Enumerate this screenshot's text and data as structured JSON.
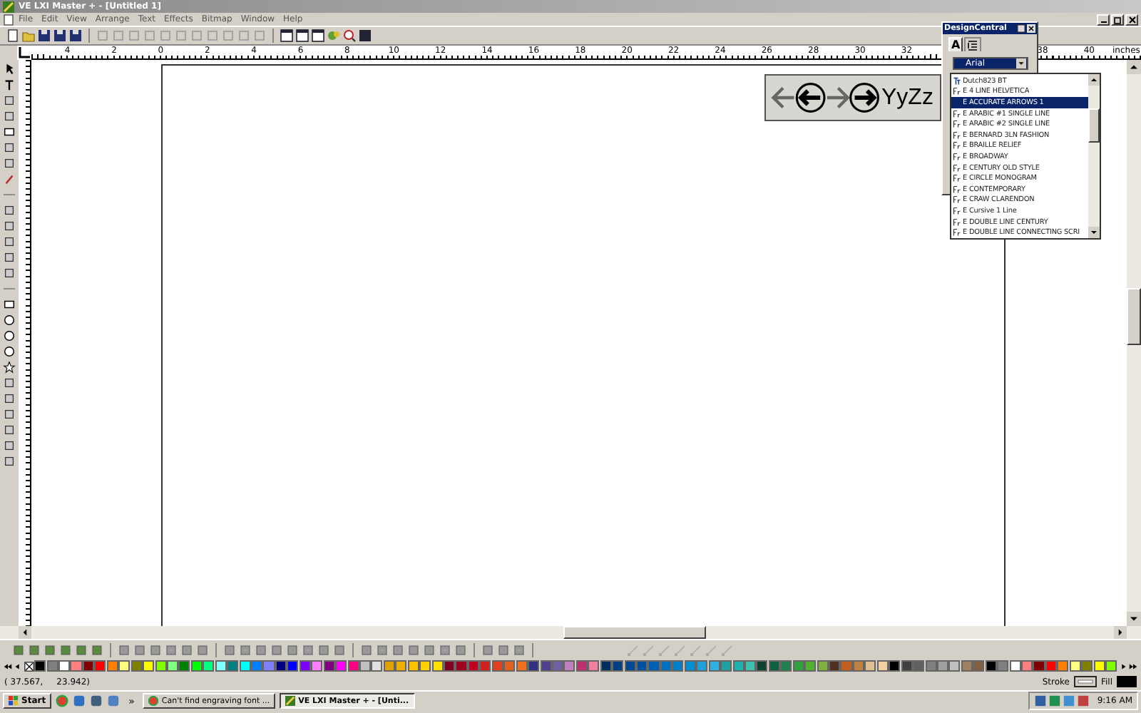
{
  "window": {
    "title": "VE LXI Master + - [Untitled 1]"
  },
  "menu": [
    "File",
    "Edit",
    "View",
    "Arrange",
    "Text",
    "Effects",
    "Bitmap",
    "Window",
    "Help"
  ],
  "ruler": {
    "labels": [
      "4",
      "2",
      "0",
      "2",
      "4",
      "6",
      "8",
      "10",
      "12",
      "14",
      "16",
      "18",
      "20",
      "22",
      "24",
      "26",
      "28",
      "30",
      "32"
    ],
    "labels_end": [
      "38",
      "40"
    ],
    "unit": "inches"
  },
  "preview": {
    "sample_text": "YyZz"
  },
  "design_central": {
    "title": "DesignCentral",
    "tabs": [
      {
        "kind": "text",
        "label": "A",
        "selected": true
      },
      {
        "kind": "icon",
        "selected": false
      }
    ],
    "font_field": {
      "value": "Arial"
    }
  },
  "font_list": {
    "items": [
      {
        "name": "Dutch823 BT",
        "kind": "truetype",
        "selected": false
      },
      {
        "name": "E 4 LINE HELVETICA",
        "kind": "engraving",
        "selected": false
      },
      {
        "name": "E ACCURATE ARROWS 1",
        "kind": "engraving",
        "selected": true
      },
      {
        "name": "E ARABIC #1 SINGLE LINE",
        "kind": "engraving",
        "selected": false
      },
      {
        "name": "E ARABIC #2 SINGLE LINE",
        "kind": "engraving",
        "selected": false
      },
      {
        "name": "E BERNARD 3LN FASHION",
        "kind": "engraving",
        "selected": false
      },
      {
        "name": "E BRAILLE RELIEF",
        "kind": "engraving",
        "selected": false
      },
      {
        "name": "E BROADWAY",
        "kind": "engraving",
        "selected": false
      },
      {
        "name": "E CENTURY OLD STYLE",
        "kind": "engraving",
        "selected": false
      },
      {
        "name": "E CIRCLE MONOGRAM",
        "kind": "engraving",
        "selected": false
      },
      {
        "name": "E CONTEMPORARY",
        "kind": "engraving",
        "selected": false
      },
      {
        "name": "E CRAW CLARENDON",
        "kind": "engraving",
        "selected": false
      },
      {
        "name": "E Cursive 1 Line",
        "kind": "engraving",
        "selected": false
      },
      {
        "name": "E DOUBLE LINE CENTURY",
        "kind": "engraving",
        "selected": false
      },
      {
        "name": "E DOUBLE LINE CONNECTING SCRI",
        "kind": "engraving",
        "selected": false
      }
    ]
  },
  "palette": {
    "swatches": [
      {
        "color": "#000000"
      },
      {
        "color": "#808080"
      },
      {
        "color": "#ffffff"
      },
      {
        "color": "#ff8080"
      },
      {
        "color": "#800000"
      },
      {
        "color": "#ff0000"
      },
      {
        "color": "#ff8000"
      },
      {
        "color": "#ffff80"
      },
      {
        "color": "#808000"
      },
      {
        "color": "#ffff00"
      },
      {
        "color": "#80ff00"
      },
      {
        "color": "#80ff80"
      },
      {
        "color": "#008000"
      },
      {
        "color": "#00ff00"
      },
      {
        "color": "#00ff80"
      },
      {
        "color": "#80ffff"
      },
      {
        "color": "#008080"
      },
      {
        "color": "#00ffff"
      },
      {
        "color": "#0080ff"
      },
      {
        "color": "#8080ff"
      },
      {
        "color": "#000080"
      },
      {
        "color": "#0000ff"
      },
      {
        "color": "#8000ff"
      },
      {
        "color": "#ff80ff"
      },
      {
        "color": "#800080"
      },
      {
        "color": "#ff00ff"
      },
      {
        "color": "#ff0080"
      },
      {
        "color": "#c0c0c0"
      },
      {
        "color": "#e0e0e0"
      },
      {
        "color": "#e0a000"
      },
      {
        "color": "#f0b000"
      },
      {
        "color": "#ffc000"
      },
      {
        "color": "#ffd000"
      },
      {
        "color": "#ffe000"
      },
      {
        "color": "#800020"
      },
      {
        "color": "#a00020"
      },
      {
        "color": "#c00020"
      },
      {
        "color": "#d02020"
      },
      {
        "color": "#e04020"
      },
      {
        "color": "#e06020"
      },
      {
        "color": "#f07020"
      },
      {
        "color": "#303080"
      },
      {
        "color": "#504090"
      },
      {
        "color": "#7060a0"
      },
      {
        "color": "#c080c0"
      },
      {
        "color": "#c03070"
      },
      {
        "color": "#f080a0"
      },
      {
        "color": "#003060"
      },
      {
        "color": "#004080"
      },
      {
        "color": "#004890"
      },
      {
        "color": "#0050a0"
      },
      {
        "color": "#0060b0"
      },
      {
        "color": "#0070c0"
      },
      {
        "color": "#0080c8"
      },
      {
        "color": "#0090d0"
      },
      {
        "color": "#20a0d8"
      },
      {
        "color": "#30b0e0"
      },
      {
        "color": "#20a0a0"
      },
      {
        "color": "#20b0b0"
      },
      {
        "color": "#40c0b0"
      },
      {
        "color": "#104030"
      },
      {
        "color": "#106040"
      },
      {
        "color": "#208050"
      },
      {
        "color": "#30a040"
      },
      {
        "color": "#50b030"
      },
      {
        "color": "#80b040"
      },
      {
        "color": "#503020"
      },
      {
        "color": "#c06020"
      },
      {
        "color": "#c08040"
      },
      {
        "color": "#e0c090"
      },
      {
        "color": "#f0d0a0"
      },
      {
        "color": "#000001"
      },
      {
        "color": "#404040"
      },
      {
        "color": "#606060"
      },
      {
        "color": "#808081"
      },
      {
        "color": "#a0a0a0"
      },
      {
        "color": "#c0c0c1"
      },
      {
        "color": "#a08060"
      },
      {
        "color": "#806040"
      },
      {
        "color": "#000002"
      },
      {
        "color": "#808082"
      },
      {
        "color": "#fffffe"
      },
      {
        "color": "#ff8081"
      },
      {
        "color": "#800001"
      },
      {
        "color": "#fe0000"
      },
      {
        "color": "#ff8001"
      },
      {
        "color": "#ffff81"
      },
      {
        "color": "#808001"
      },
      {
        "color": "#fefe00"
      },
      {
        "color": "#80ff01"
      }
    ]
  },
  "status": {
    "coordinates": "( 37.567,     23.942)",
    "stroke_label": "Stroke",
    "fill_label": "Fill"
  },
  "taskbar": {
    "start": "Start",
    "more": "»",
    "tasks": [
      {
        "label": "Can't find engraving font ...",
        "selected": false
      },
      {
        "label": "VE LXI Master + - [Unti...",
        "selected": true
      }
    ],
    "clock": "9:16 AM"
  }
}
